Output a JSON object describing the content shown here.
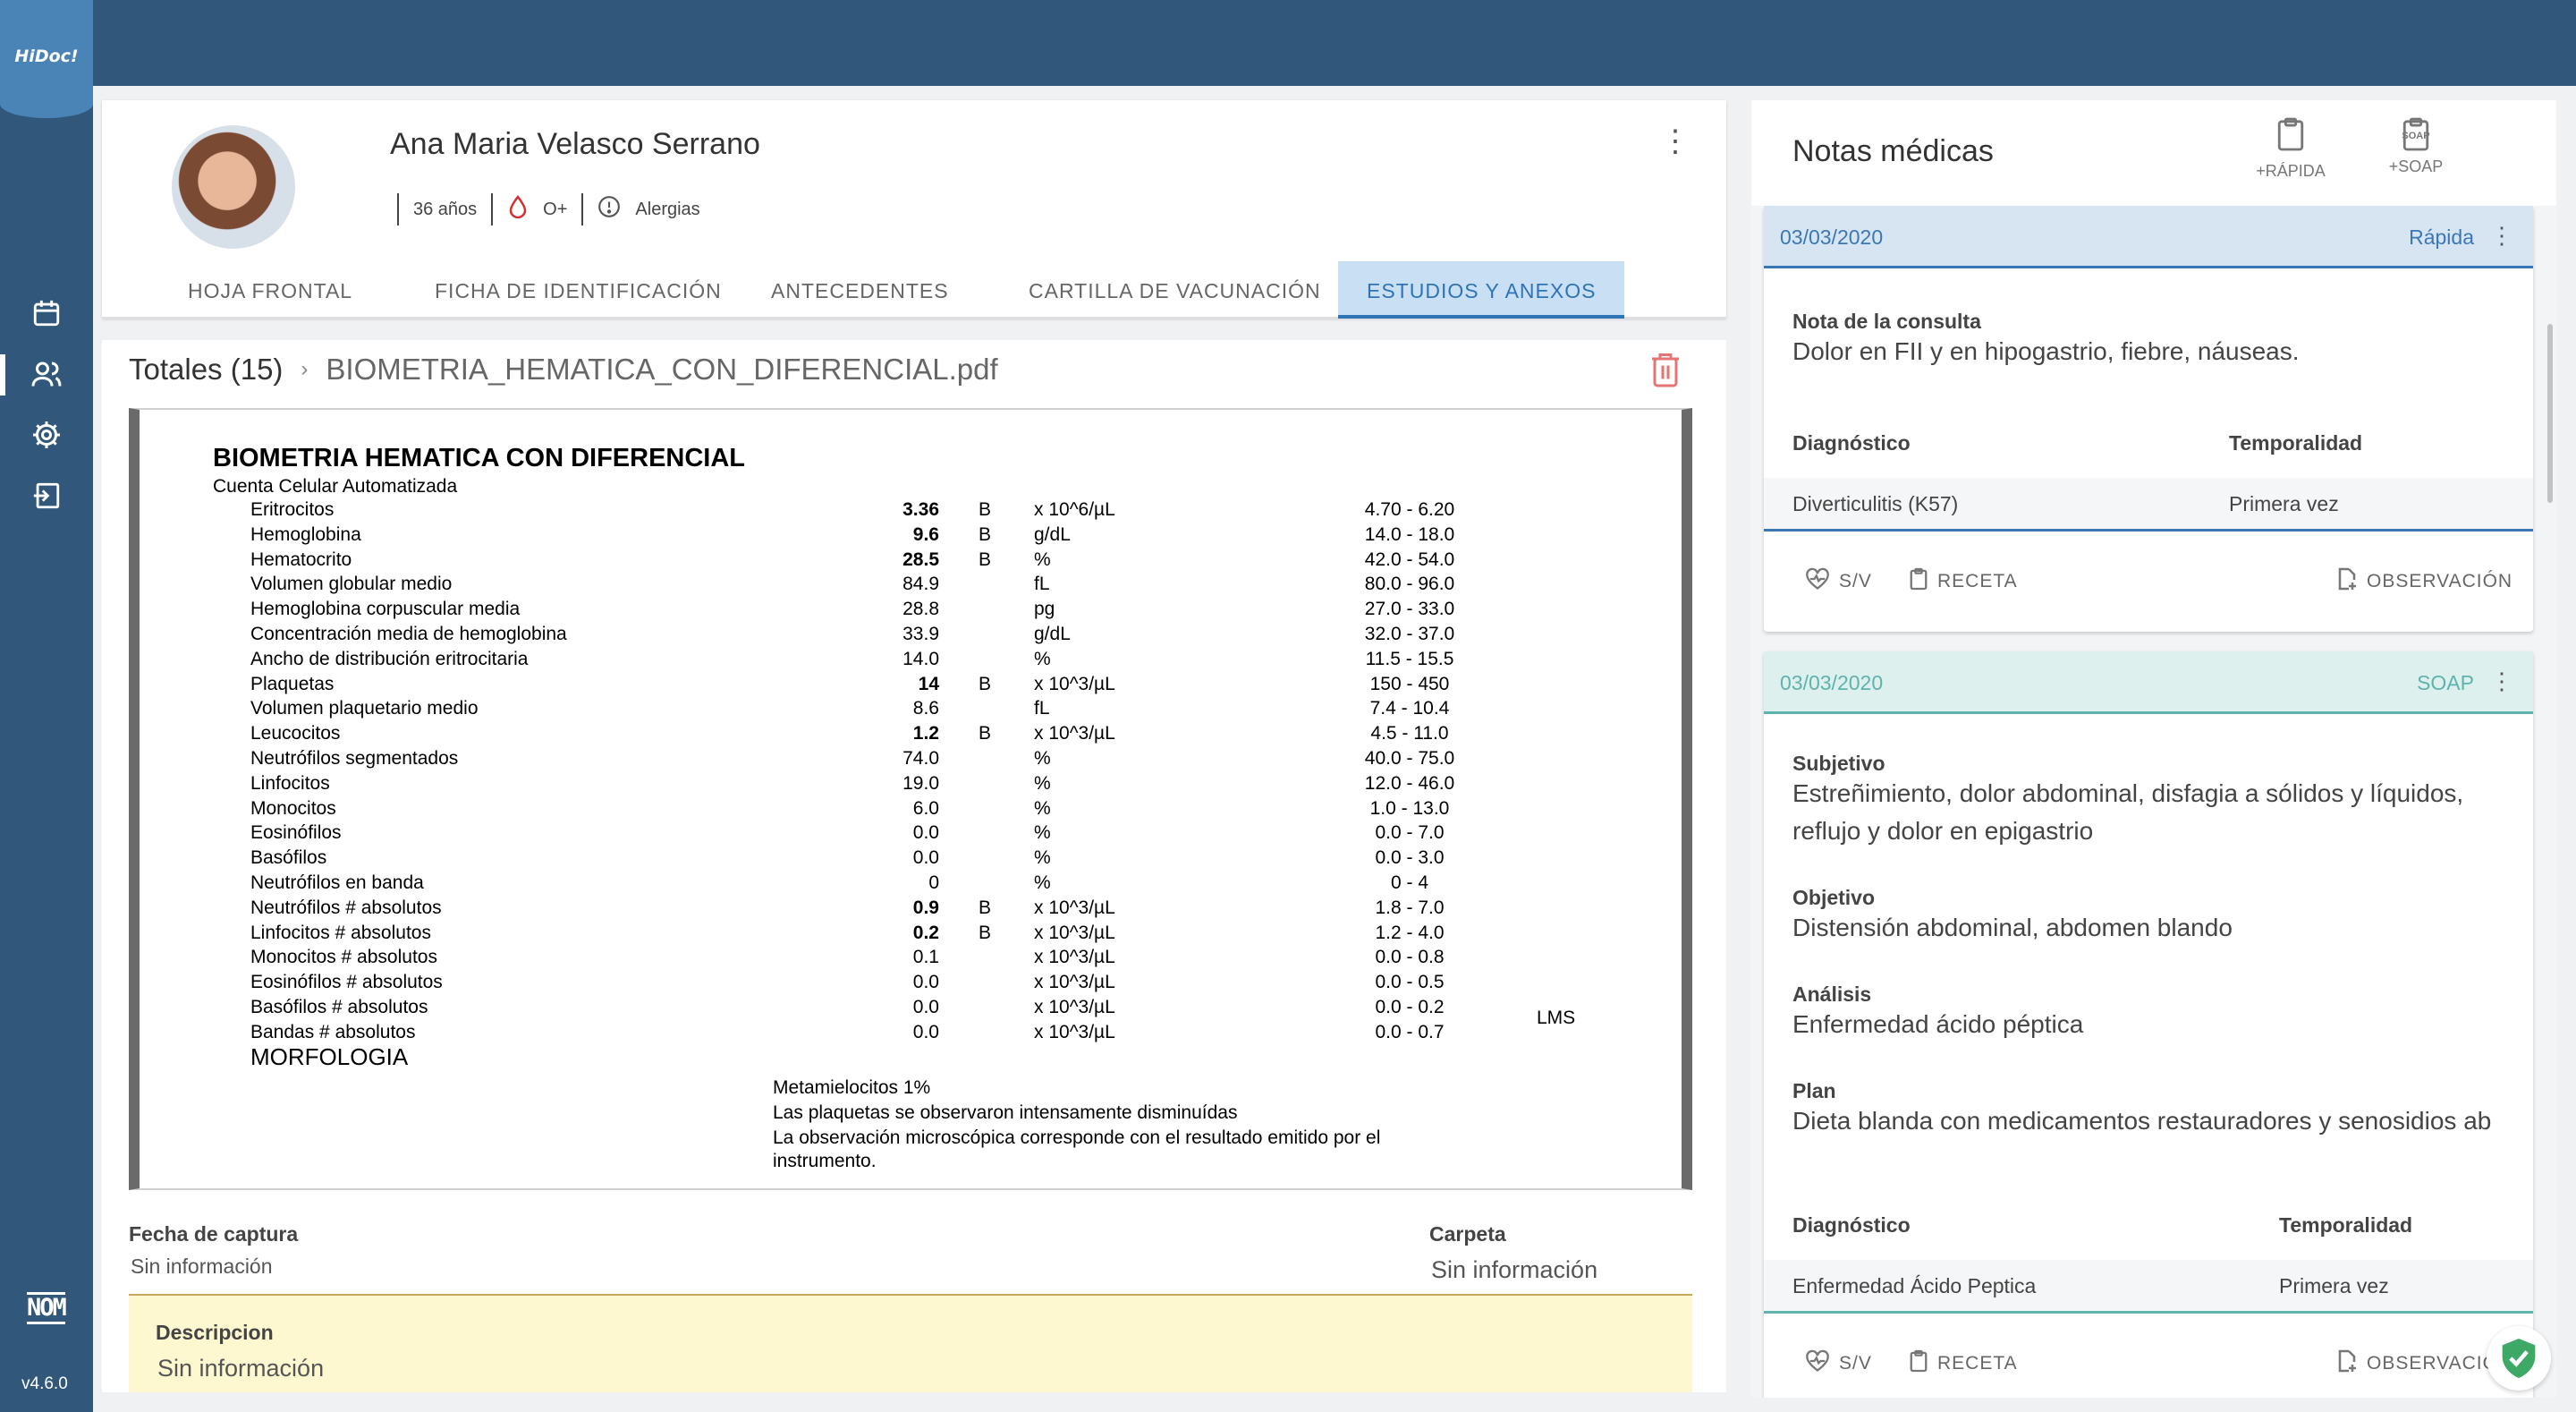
{
  "app": {
    "logo": "HiDoc!",
    "version": "v4.6.0",
    "nom_badge": "NOM"
  },
  "patient": {
    "name": "Ana Maria Velasco Serrano",
    "age": "36 años",
    "blood_type": "O+",
    "allergies": "Alergias"
  },
  "tabs": [
    {
      "label": "HOJA FRONTAL"
    },
    {
      "label": "FICHA DE IDENTIFICACIÓN"
    },
    {
      "label": "ANTECEDENTES"
    },
    {
      "label": "CARTILLA DE VACUNACIÓN"
    },
    {
      "label": "ESTUDIOS Y ANEXOS"
    }
  ],
  "breadcrumb": {
    "root": "Totales (15)",
    "file": "BIOMETRIA_HEMATICA_CON_DIFERENCIAL.pdf"
  },
  "document": {
    "title": "BIOMETRIA HEMATICA CON DIFERENCIAL",
    "subtitle": "Cuenta Celular Automatizada",
    "rows": [
      {
        "name": "Eritrocitos",
        "value": "3.36",
        "bold": true,
        "flag": "B",
        "unit": "x 10^6/µL",
        "ref": "4.70 - 6.20"
      },
      {
        "name": "Hemoglobina",
        "value": "9.6",
        "bold": true,
        "flag": "B",
        "unit": "g/dL",
        "ref": "14.0 - 18.0"
      },
      {
        "name": "Hematocrito",
        "value": "28.5",
        "bold": true,
        "flag": "B",
        "unit": "%",
        "ref": "42.0 - 54.0"
      },
      {
        "name": "Volumen globular medio",
        "value": "84.9",
        "bold": false,
        "flag": "",
        "unit": "fL",
        "ref": "80.0 - 96.0"
      },
      {
        "name": "Hemoglobina corpuscular media",
        "value": "28.8",
        "bold": false,
        "flag": "",
        "unit": "pg",
        "ref": "27.0 - 33.0"
      },
      {
        "name": "Concentración media de hemoglobina",
        "value": "33.9",
        "bold": false,
        "flag": "",
        "unit": "g/dL",
        "ref": "32.0 - 37.0"
      },
      {
        "name": "Ancho de distribución eritrocitaria",
        "value": "14.0",
        "bold": false,
        "flag": "",
        "unit": "%",
        "ref": "11.5 - 15.5"
      },
      {
        "name": "Plaquetas",
        "value": "14",
        "bold": true,
        "flag": "B",
        "unit": "x 10^3/µL",
        "ref": "150 - 450"
      },
      {
        "name": "Volumen plaquetario medio",
        "value": "8.6",
        "bold": false,
        "flag": "",
        "unit": "fL",
        "ref": "7.4 - 10.4"
      },
      {
        "name": "Leucocitos",
        "value": "1.2",
        "bold": true,
        "flag": "B",
        "unit": "x 10^3/µL",
        "ref": "4.5 - 11.0"
      },
      {
        "name": "Neutrófilos segmentados",
        "value": "74.0",
        "bold": false,
        "flag": "",
        "unit": "%",
        "ref": "40.0 - 75.0"
      },
      {
        "name": "Linfocitos",
        "value": "19.0",
        "bold": false,
        "flag": "",
        "unit": "%",
        "ref": "12.0 - 46.0"
      },
      {
        "name": "Monocitos",
        "value": "6.0",
        "bold": false,
        "flag": "",
        "unit": "%",
        "ref": "1.0 - 13.0"
      },
      {
        "name": "Eosinófilos",
        "value": "0.0",
        "bold": false,
        "flag": "",
        "unit": "%",
        "ref": "0.0 - 7.0"
      },
      {
        "name": "Basófilos",
        "value": "0.0",
        "bold": false,
        "flag": "",
        "unit": "%",
        "ref": "0.0 - 3.0"
      },
      {
        "name": "Neutrófilos en banda",
        "value": "0",
        "bold": false,
        "flag": "",
        "unit": "%",
        "ref": "0 - 4"
      },
      {
        "name": "Neutrófilos # absolutos",
        "value": "0.9",
        "bold": true,
        "flag": "B",
        "unit": "x 10^3/µL",
        "ref": "1.8 - 7.0"
      },
      {
        "name": "Linfocitos # absolutos",
        "value": "0.2",
        "bold": true,
        "flag": "B",
        "unit": "x 10^3/µL",
        "ref": "1.2 - 4.0"
      },
      {
        "name": "Monocitos # absolutos",
        "value": "0.1",
        "bold": false,
        "flag": "",
        "unit": "x 10^3/µL",
        "ref": "0.0 - 0.8"
      },
      {
        "name": "Eosinófilos # absolutos",
        "value": "0.0",
        "bold": false,
        "flag": "",
        "unit": "x 10^3/µL",
        "ref": "0.0 - 0.5"
      },
      {
        "name": "Basófilos # absolutos",
        "value": "0.0",
        "bold": false,
        "flag": "",
        "unit": "x 10^3/µL",
        "ref": "0.0 - 0.2"
      },
      {
        "name": "Bandas # absolutos",
        "value": "0.0",
        "bold": false,
        "flag": "",
        "unit": "x 10^3/µL",
        "ref": "0.0 - 0.7"
      }
    ],
    "lms": "LMS",
    "morphology_title": "MORFOLOGIA",
    "morphology_notes": [
      "Metamielocitos 1%",
      "Las plaquetas se observaron intensamente disminuídas",
      "La observación microscópica corresponde con el resultado emitido por el",
      "instrumento."
    ]
  },
  "fields": {
    "capture_date_label": "Fecha de captura",
    "capture_date_value": "Sin información",
    "folder_label": "Carpeta",
    "folder_value": "Sin información",
    "description_label": "Descripcion",
    "description_value": "Sin información"
  },
  "notes": {
    "title": "Notas médicas",
    "quick_button": "+RÁPIDA",
    "soap_button": "+SOAP",
    "soap_icon_text": "SOAP",
    "cards": [
      {
        "date": "03/03/2020",
        "type": "Rápida",
        "consult_label": "Nota de la consulta",
        "consult_text": "Dolor en FII y en hipogastrio, fiebre, náuseas.",
        "dx_label": "Diagnóstico",
        "temp_label": "Temporalidad",
        "dx_value": "Diverticulitis (K57)",
        "temp_value": "Primera vez",
        "actions": {
          "sv": "S/V",
          "recipe": "RECETA",
          "observation": "OBSERVACIÓN"
        }
      },
      {
        "date": "03/03/2020",
        "type": "SOAP",
        "subjective_label": "Subjetivo",
        "subjective_text": "Estreñimiento, dolor abdominal, disfagia a sólidos y líquidos, reflujo y dolor en epigastrio",
        "objective_label": "Objetivo",
        "objective_text": "Distensión abdominal, abdomen blando",
        "analysis_label": "Análisis",
        "analysis_text": "Enfermedad ácido péptica",
        "plan_label": "Plan",
        "plan_text": "Dieta blanda con medicamentos restauradores y senosidios ab",
        "dx_label": "Diagnóstico",
        "temp_label": "Temporalidad",
        "dx_value": "Enfermedad Ácido Peptica",
        "temp_value": "Primera vez",
        "actions": {
          "sv": "S/V",
          "recipe": "RECETA",
          "observation": "OBSERVACIÓN"
        }
      }
    ]
  },
  "colors": {
    "sidebar": "#31587b",
    "accent": "#2f74b5",
    "quick_note": "#3a78b5",
    "soap_note": "#5fb3ad",
    "description_bg": "#fdf8cf",
    "trash": "#e57373"
  }
}
